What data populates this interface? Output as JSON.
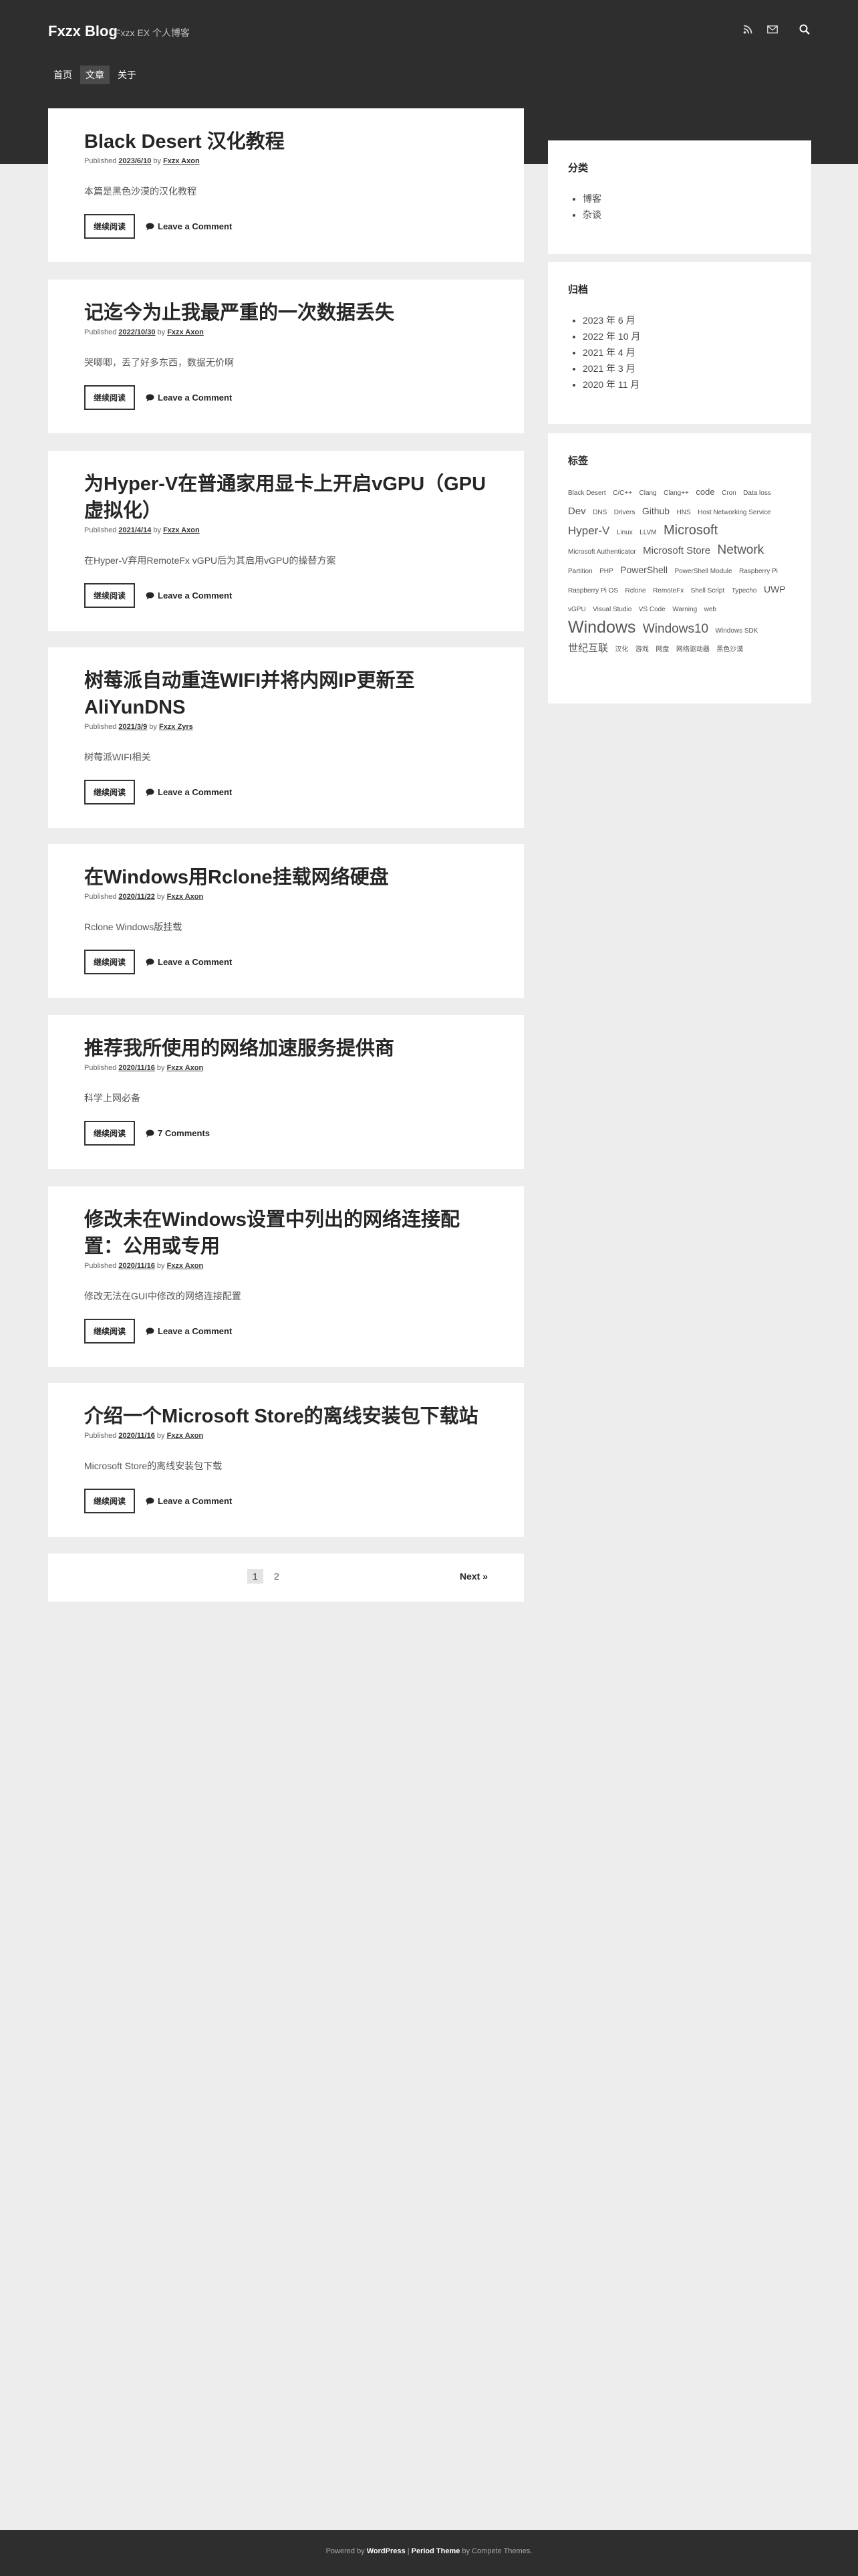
{
  "site": {
    "title": "Fxzx Blog",
    "description": "Fxzx EX 个人博客"
  },
  "nav": [
    "首页",
    "文章",
    "关于"
  ],
  "posts": [
    {
      "title": "Black Desert 汉化教程",
      "published": "Published",
      "date": "2023/6/10",
      "by": "by",
      "author": "Fxzx Axon",
      "excerpt": "本篇是黑色沙漠的汉化教程",
      "more": "继续阅读",
      "comments": "Leave a Comment"
    },
    {
      "title": "记迄今为止我最严重的一次数据丢失",
      "published": "Published",
      "date": "2022/10/30",
      "by": "by",
      "author": "Fxzx Axon",
      "excerpt": "哭唧唧，丢了好多东西，数据无价啊",
      "more": "继续阅读",
      "comments": "Leave a Comment"
    },
    {
      "title": "为Hyper-V在普通家用显卡上开启vGPU（GPU虚拟化）",
      "published": "Published",
      "date": "2021/4/14",
      "by": "by",
      "author": "Fxzx Axon",
      "excerpt": "在Hyper-V弃用RemoteFx vGPU后为其启用vGPU的操替方案",
      "more": "继续阅读",
      "comments": "Leave a Comment"
    },
    {
      "title": "树莓派自动重连WIFI并将内网IP更新至AliYunDNS",
      "published": "Published",
      "date": "2021/3/9",
      "by": "by",
      "author": "Fxzx Zyrs",
      "excerpt": "树莓派WIFI相关",
      "more": "继续阅读",
      "comments": "Leave a Comment"
    },
    {
      "title": "在Windows用Rclone挂载网络硬盘",
      "published": "Published",
      "date": "2020/11/22",
      "by": "by",
      "author": "Fxzx Axon",
      "excerpt": "Rclone Windows版挂载",
      "more": "继续阅读",
      "comments": "Leave a Comment"
    },
    {
      "title": "推荐我所使用的网络加速服务提供商",
      "published": "Published",
      "date": "2020/11/16",
      "by": "by",
      "author": "Fxzx Axon",
      "excerpt": "科学上网必备",
      "more": "继续阅读",
      "comments": "7 Comments"
    },
    {
      "title": "修改未在Windows设置中列出的网络连接配置：公用或专用",
      "published": "Published",
      "date": "2020/11/16",
      "by": "by",
      "author": "Fxzx Axon",
      "excerpt": "修改无法在GUI中修改的网络连接配置",
      "more": "继续阅读",
      "comments": "Leave a Comment"
    },
    {
      "title": "介绍一个Microsoft Store的离线安装包下载站",
      "published": "Published",
      "date": "2020/11/16",
      "by": "by",
      "author": "Fxzx Axon",
      "excerpt": "Microsoft Store的离线安装包下载",
      "more": "继续阅读",
      "comments": "Leave a Comment"
    }
  ],
  "pagination": {
    "pages": [
      "1",
      "2"
    ],
    "next": "Next »"
  },
  "sidebar": {
    "categories": {
      "title": "分类",
      "items": [
        "博客",
        "杂谈"
      ]
    },
    "archives": {
      "title": "归档",
      "items": [
        "2023 年 6 月",
        "2022 年 10 月",
        "2021 年 4 月",
        "2021 年 3 月",
        "2020 年 11 月"
      ]
    },
    "tags": {
      "title": "标签",
      "items": [
        "Black Desert",
        "C/C++",
        "Clang",
        "Clang++",
        "code",
        "Cron",
        "Data loss",
        "Dev",
        "DNS",
        "Drivers",
        "Github",
        "HNS",
        "Host Networking Service",
        "Hyper-V",
        "Linux",
        "LLVM",
        "Microsoft",
        "Microsoft Authenticator",
        "Microsoft Store",
        "Network",
        "Partition",
        "PHP",
        "PowerShell",
        "PowerShell Module",
        "Raspberry Pi",
        "Raspberry Pi OS",
        "Rclone",
        "RemoteFx",
        "Shell Script",
        "Typecho",
        "UWP",
        "vGPU",
        "Visual Studio",
        "VS Code",
        "Warning",
        "web",
        "Windows",
        "Windows10",
        "Windows SDK",
        "世纪互联",
        "汉化",
        "游戏",
        "网盘",
        "网络驱动器",
        "黑色沙漠"
      ]
    }
  },
  "footer": {
    "powered": "Powered by",
    "wordpress": "WordPress",
    "sep": "|",
    "theme": "Period Theme",
    "by": "by Compete Themes."
  },
  "colors": {
    "header_bg": "#2e2e2e",
    "page_bg": "#ededed",
    "card_bg": "#ffffff"
  }
}
